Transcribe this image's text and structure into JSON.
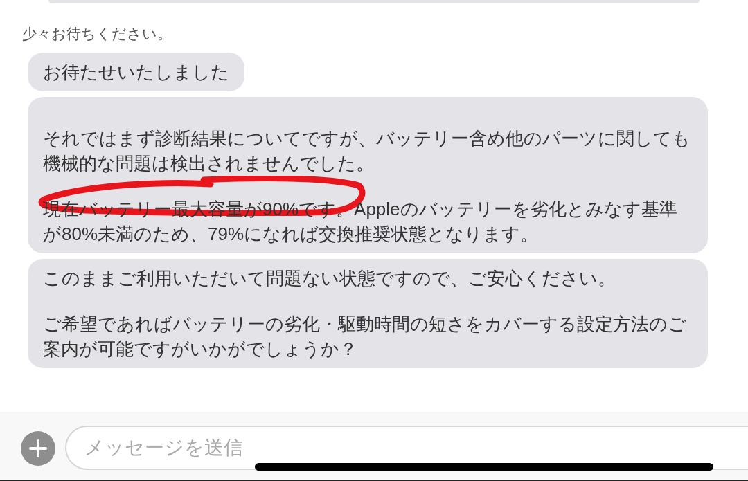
{
  "status_text": "少々お待ちください。",
  "messages": [
    {
      "paragraphs": [
        "お待たせいたしました"
      ],
      "lead_gap": false,
      "annotated": false
    },
    {
      "paragraphs": [
        "それではまず診断結果についてですが、バッテリー含め他のパーツに関しても機械的な問題は検出されませんでした。",
        "現在バッテリー最大容量が90%です。Appleのバッテリーを劣化とみなす基準が80%未満のため、79%になれば交換推奨状態となります。"
      ],
      "lead_gap": true,
      "annotated": true
    },
    {
      "paragraphs": [
        "このままご利用いただいて問題ない状態ですので、ご安心ください。",
        "ご希望であればバッテリーの劣化・駆動時間の短さをカバーする設定方法のご案内が可能ですがいかがでしょうか？"
      ],
      "lead_gap": false,
      "annotated": false
    }
  ],
  "composer": {
    "placeholder": "メッセージを送信"
  }
}
